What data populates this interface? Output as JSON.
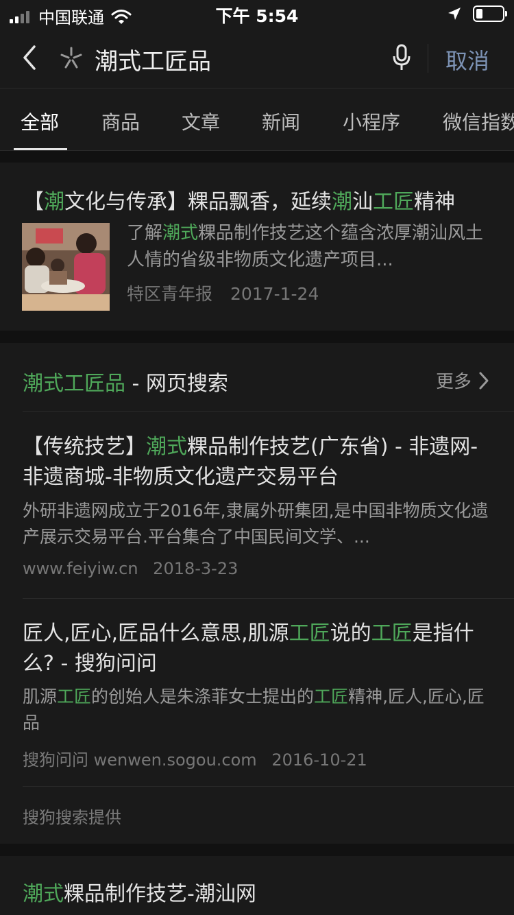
{
  "status_bar": {
    "carrier": "中国联通",
    "time": "下午 5:54",
    "battery_level": 0.25
  },
  "search": {
    "query": "潮式工匠品",
    "cancel_label": "取消"
  },
  "tabs": [
    {
      "label": "全部",
      "active": true
    },
    {
      "label": "商品",
      "active": false
    },
    {
      "label": "文章",
      "active": false
    },
    {
      "label": "新闻",
      "active": false
    },
    {
      "label": "小程序",
      "active": false
    },
    {
      "label": "微信指数",
      "active": false
    }
  ],
  "article": {
    "title_parts": [
      {
        "text": "【",
        "hl": false
      },
      {
        "text": "潮",
        "hl": true
      },
      {
        "text": "文化与传承】粿品飘香，延续",
        "hl": false
      },
      {
        "text": "潮",
        "hl": true
      },
      {
        "text": "汕",
        "hl": false
      },
      {
        "text": "工匠",
        "hl": true
      },
      {
        "text": "精神",
        "hl": false
      }
    ],
    "desc_parts": [
      {
        "text": "了解",
        "hl": false
      },
      {
        "text": "潮式",
        "hl": true
      },
      {
        "text": "粿品制作技艺这个蕴含浓厚潮汕风土人情的省级非物质文化遗产项目...",
        "hl": false
      }
    ],
    "source": "特区青年报",
    "date": "2017-1-24"
  },
  "web_search": {
    "heading_highlight": "潮式工匠品",
    "heading_rest": " - 网页搜索",
    "more_label": "更多",
    "results": [
      {
        "title_parts": [
          {
            "text": "【传统技艺】",
            "hl": false
          },
          {
            "text": "潮式",
            "hl": true
          },
          {
            "text": "粿品制作技艺(广东省) - 非遗网-非遗商城-非物质文化遗产交易平台",
            "hl": false
          }
        ],
        "desc_parts": [
          {
            "text": "外研非遗网成立于2016年,隶属外研集团,是中国非物质文化遗产展示交易平台.平台集合了中国民间文学、...",
            "hl": false
          }
        ],
        "meta_source": "www.feiyiw.cn",
        "meta_date": "2018-3-23"
      },
      {
        "title_parts": [
          {
            "text": "匠人,匠心,匠品什么意思,肌源",
            "hl": false
          },
          {
            "text": "工匠",
            "hl": true
          },
          {
            "text": "说的",
            "hl": false
          },
          {
            "text": "工匠",
            "hl": true
          },
          {
            "text": "是指什么? - 搜狗问问",
            "hl": false
          }
        ],
        "desc_parts": [
          {
            "text": "肌源",
            "hl": false
          },
          {
            "text": "工匠",
            "hl": true
          },
          {
            "text": "的创始人是朱涤菲女士提出的",
            "hl": false
          },
          {
            "text": "工匠",
            "hl": true
          },
          {
            "text": "精神,匠人,匠心,匠品",
            "hl": false
          }
        ],
        "meta_source": "搜狗问问 wenwen.sogou.com",
        "meta_date": "2016-10-21"
      }
    ],
    "provider": "搜狗搜索提供"
  },
  "bottom_result": {
    "title_parts": [
      {
        "text": "潮式",
        "hl": true
      },
      {
        "text": "粿品制作技艺-潮汕网",
        "hl": false
      }
    ]
  },
  "colors": {
    "highlight": "#4fa85a",
    "cancel": "#7d93b5",
    "background": "#111111",
    "card": "#1a1a1a"
  }
}
